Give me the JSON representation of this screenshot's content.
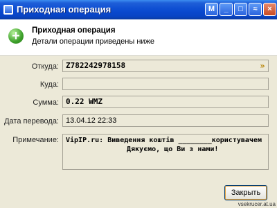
{
  "window": {
    "title": "Приходная операция",
    "controls": [
      "M",
      "_",
      "□",
      "≈",
      "×"
    ]
  },
  "header": {
    "title": "Приходная операция",
    "subtitle": "Детали операции приведены ниже"
  },
  "fields": {
    "from_label": "Откуда:",
    "from_value": "Z782242978158",
    "to_label": "Куда:",
    "to_value": "",
    "amount_label": "Сумма:",
    "amount_value": "0.22 WMZ",
    "date_label": "Дата перевода:",
    "date_value": "13.04.12 22:33",
    "note_label": "Примечание:",
    "note_line1": "VipIP.ru: Виведення коштів ________користувачем",
    "note_line2": "Дякуємо, що Ви з нами!"
  },
  "buttons": {
    "close_label": "Закрыть"
  },
  "watermark": "vsekrucer.at.ua"
}
